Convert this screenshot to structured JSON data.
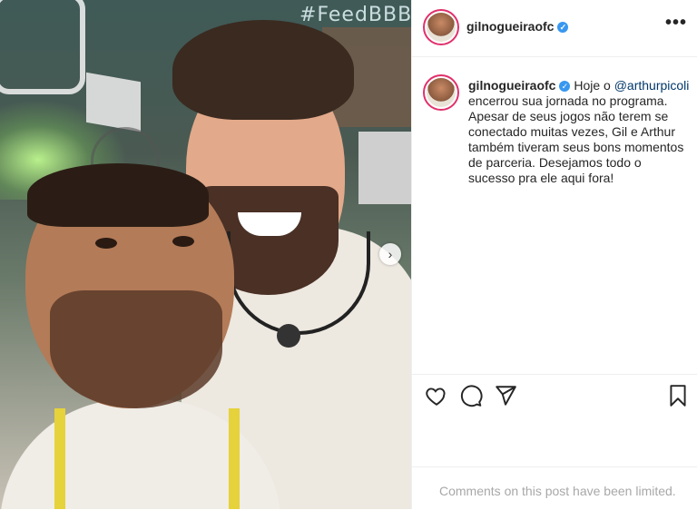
{
  "post": {
    "photo_sign_text": "#FeedBBB",
    "username": "gilnogueiraofc",
    "verified_mark": "✓",
    "more_glyph": "•••",
    "next_glyph": "›",
    "caption": {
      "username": "gilnogueiraofc",
      "text_before_mention": "Hoje o",
      "mention": "@arthurpicoli",
      "text_after_mention": "encerrou sua jornada no programa. Apesar de seus jogos não terem se conectado muitas vezes, Gil e Arthur também tiveram seus bons momentos de parceria. Desejamos todo o sucesso pra ele aqui fora!"
    },
    "actions": {
      "like_icon": "heart-icon",
      "comment_icon": "comment-icon",
      "share_icon": "share-icon",
      "save_icon": "bookmark-icon"
    },
    "comments_notice": "Comments on this post have been limited.",
    "colors": {
      "verified": "#3897f0",
      "avatar_ring": "#e1306c",
      "mention": "#00376b",
      "muted_text": "#a8a8a8"
    }
  }
}
